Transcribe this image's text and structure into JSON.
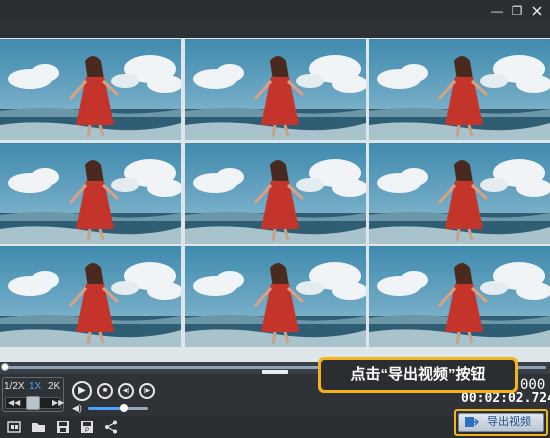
{
  "window": {
    "minimize_glyph": "—",
    "restore_glyph": "❐"
  },
  "video": {
    "grid_rows": 3,
    "grid_cols": 3,
    "scene": "woman in red dress running on beach",
    "colors": {
      "sky": "#6fa9c4",
      "cloud": "#f1f4f6",
      "sea": "#2f5d73",
      "dress": "#c4342b",
      "hair": "#4a2a1e"
    }
  },
  "playback": {
    "progress": 0.0,
    "speeds": [
      "1/2X",
      "1X",
      "2K"
    ],
    "active_speed": "1X",
    "jog_back": "◀◀",
    "jog_forward": "▶▶",
    "play_glyph": "▶",
    "stop_glyph": "■",
    "prev_glyph": "◀|",
    "next_glyph": "|▶",
    "volume_level": 0.6,
    "timecode_top": "000",
    "timecode": "00:02:02.724"
  },
  "callout": {
    "text": "点击“导出视频”按钮"
  },
  "toolbar": {
    "items": [
      {
        "icon": "camera-icon",
        "glyph": "▣"
      },
      {
        "icon": "folder-open-icon",
        "glyph": "▰"
      },
      {
        "icon": "save-icon",
        "glyph": "▤"
      },
      {
        "icon": "save-as-icon",
        "glyph": "▥"
      },
      {
        "icon": "share-icon",
        "glyph": "≺"
      }
    ],
    "export_label": "导出视频"
  },
  "accent_color": "#4aa3ff",
  "highlight_color": "#f4b21e"
}
